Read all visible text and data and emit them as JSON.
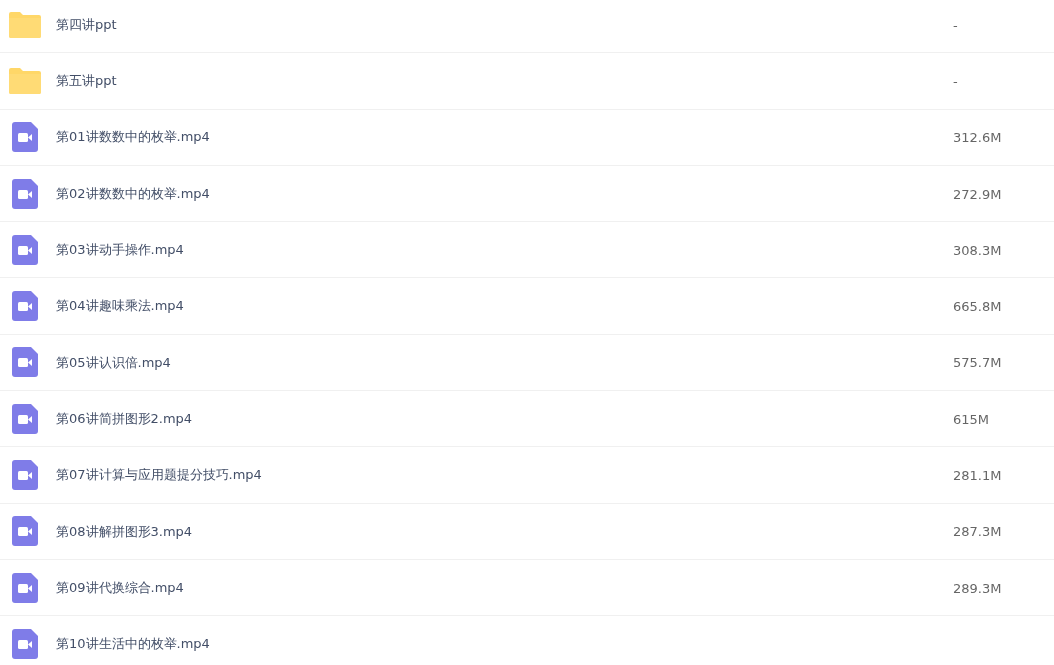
{
  "files": [
    {
      "kind": "folder",
      "name": "第四讲ppt",
      "size": "-"
    },
    {
      "kind": "folder",
      "name": "第五讲ppt",
      "size": "-"
    },
    {
      "kind": "video",
      "name": "第01讲数数中的枚举.mp4",
      "size": "312.6M"
    },
    {
      "kind": "video",
      "name": "第02讲数数中的枚举.mp4",
      "size": "272.9M"
    },
    {
      "kind": "video",
      "name": "第03讲动手操作.mp4",
      "size": "308.3M"
    },
    {
      "kind": "video",
      "name": "第04讲趣味乘法.mp4",
      "size": "665.8M"
    },
    {
      "kind": "video",
      "name": "第05讲认识倍.mp4",
      "size": "575.7M"
    },
    {
      "kind": "video",
      "name": "第06讲简拼图形2.mp4",
      "size": "615M"
    },
    {
      "kind": "video",
      "name": "第07讲计算与应用题提分技巧.mp4",
      "size": "281.1M"
    },
    {
      "kind": "video",
      "name": "第08讲解拼图形3.mp4",
      "size": "287.3M"
    },
    {
      "kind": "video",
      "name": "第09讲代换综合.mp4",
      "size": "289.3M"
    },
    {
      "kind": "video",
      "name": "第10讲生活中的枚举.mp4"
    }
  ]
}
